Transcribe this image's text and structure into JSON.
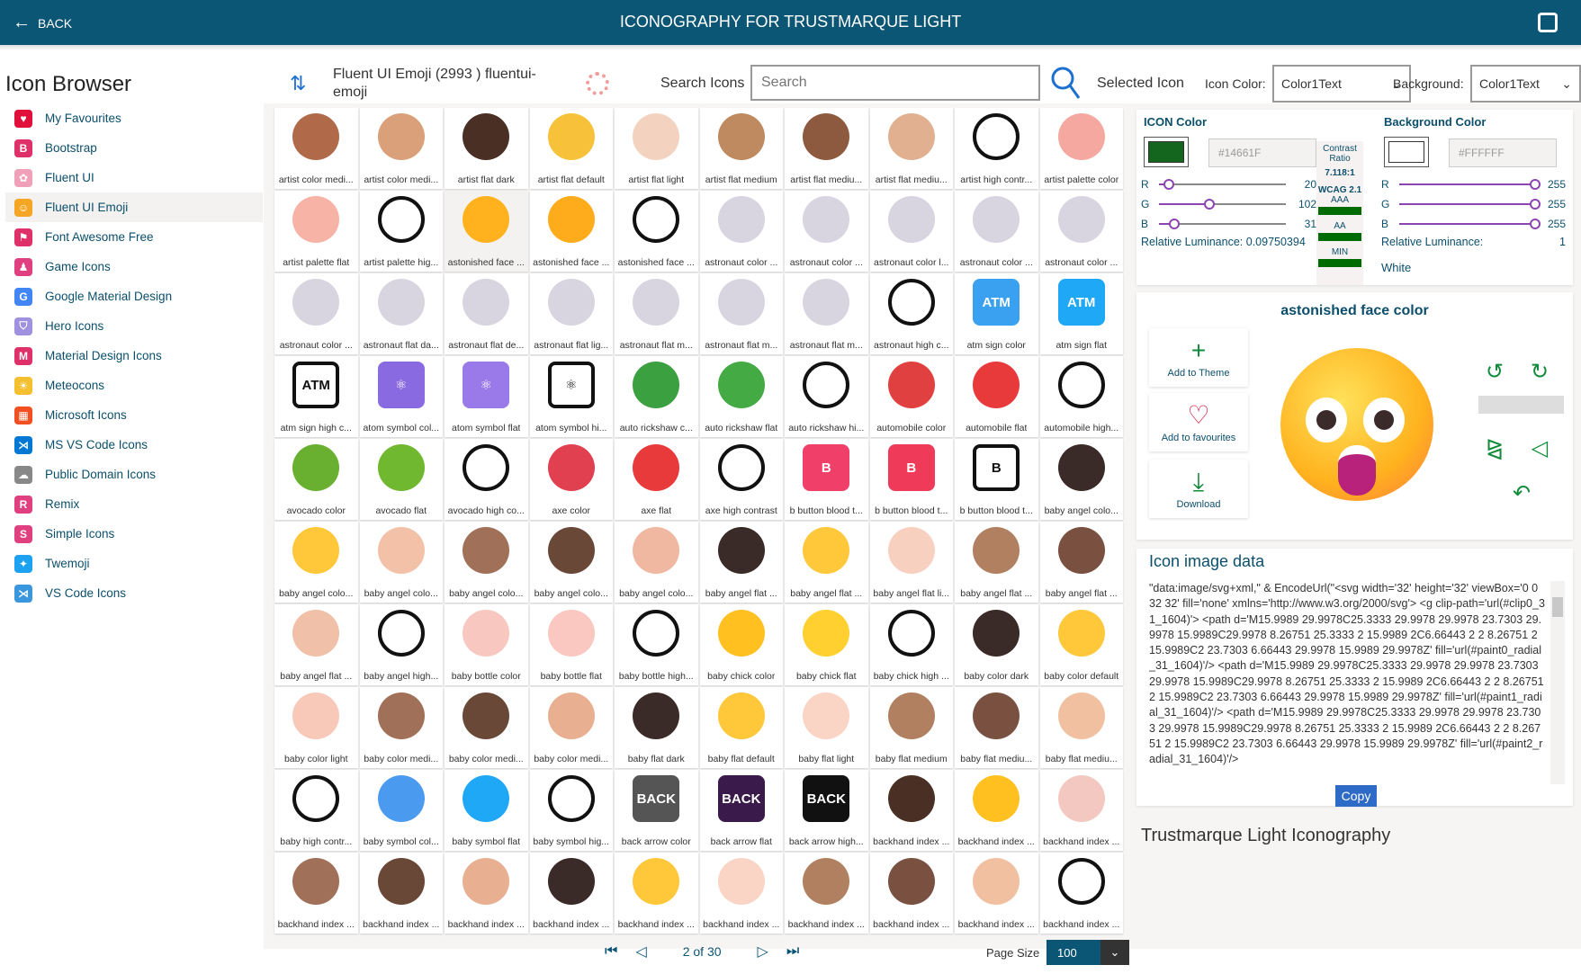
{
  "header": {
    "back_label": "BACK",
    "title": "ICONOGRAPHY FOR TRUSTMARQUE LIGHT"
  },
  "sidebar": {
    "title": "Icon Browser",
    "items": [
      {
        "label": "My Favourites",
        "icon": "heart-icon",
        "color": "#e0103a",
        "glyph": "♥"
      },
      {
        "label": "Bootstrap",
        "icon": "bootstrap-icon",
        "color": "#e0306a",
        "glyph": "B"
      },
      {
        "label": "Fluent UI",
        "icon": "fluent-icon",
        "color": "#f0a0b8",
        "glyph": "✿"
      },
      {
        "label": "Fluent UI Emoji",
        "icon": "cat-emoji-icon",
        "color": "#f5a623",
        "glyph": "☺",
        "active": true
      },
      {
        "label": "Font Awesome Free",
        "icon": "flag-icon",
        "color": "#e0306a",
        "glyph": "⚑"
      },
      {
        "label": "Game Icons",
        "icon": "game-icon",
        "color": "#e04080",
        "glyph": "♟"
      },
      {
        "label": "Google Material Design",
        "icon": "google-icon",
        "color": "#4285f4",
        "glyph": "G"
      },
      {
        "label": "Hero Icons",
        "icon": "shield-icon",
        "color": "#a090e0",
        "glyph": "⛉"
      },
      {
        "label": "Material Design Icons",
        "icon": "material-icon",
        "color": "#e0306a",
        "glyph": "M"
      },
      {
        "label": "Meteocons",
        "icon": "sun-icon",
        "color": "#f5c030",
        "glyph": "☀"
      },
      {
        "label": "Microsoft Icons",
        "icon": "windows-icon",
        "color": "#f25022",
        "glyph": "▦"
      },
      {
        "label": "MS VS Code Icons",
        "icon": "vscode-icon",
        "color": "#0078d4",
        "glyph": "⋊"
      },
      {
        "label": "Public Domain Icons",
        "icon": "cloud-icon",
        "color": "#888888",
        "glyph": "☁"
      },
      {
        "label": "Remix",
        "icon": "remix-icon",
        "color": "#e04080",
        "glyph": "R"
      },
      {
        "label": "Simple Icons",
        "icon": "simple-icon",
        "color": "#e04080",
        "glyph": "S"
      },
      {
        "label": "Twemoji",
        "icon": "twitter-icon",
        "color": "#1da1f2",
        "glyph": "✦"
      },
      {
        "label": "VS Code Icons",
        "icon": "vscode-icon",
        "color": "#3a96dd",
        "glyph": "⋊"
      }
    ]
  },
  "toolbar": {
    "set_name": "Fluent UI Emoji (2993 ) fluentui-emoji",
    "search_label": "Search Icons",
    "search_placeholder": "Search",
    "selected_icon_label": "Selected Icon",
    "icon_color_label": "Icon Color:",
    "icon_color_value": "Color1Text",
    "background_label": "Background:",
    "background_value": "Color1Text"
  },
  "grid": {
    "items": [
      [
        "artist color medi...",
        "#b06a4a",
        ""
      ],
      [
        "artist color medi...",
        "#d9a07a",
        ""
      ],
      [
        "artist flat dark",
        "#4a2f25",
        ""
      ],
      [
        "artist flat default",
        "#f7c23a",
        ""
      ],
      [
        "artist flat light",
        "#f3d3c0",
        ""
      ],
      [
        "artist flat medium",
        "#c08a60",
        ""
      ],
      [
        "artist flat mediu...",
        "#8d5a40",
        ""
      ],
      [
        "artist flat mediu...",
        "#e0b090",
        ""
      ],
      [
        "artist high contr...",
        "hc",
        ""
      ],
      [
        "artist palette color",
        "#f4a8a0",
        ""
      ],
      [
        "artist palette flat",
        "#f7b3a5",
        ""
      ],
      [
        "artist palette hig...",
        "hc",
        ""
      ],
      [
        "astonished face ...",
        "#ffb21e",
        ""
      ],
      [
        "astonished face ...",
        "#ffac1c",
        ""
      ],
      [
        "astonished face ...",
        "hc",
        ""
      ],
      [
        "astronaut color ...",
        "#d8d4e0",
        ""
      ],
      [
        "astronaut color ...",
        "#d8d4e0",
        ""
      ],
      [
        "astronaut color l...",
        "#d8d4e0",
        ""
      ],
      [
        "astronaut color ...",
        "#d8d4e0",
        ""
      ],
      [
        "astronaut color ...",
        "#d8d4e0",
        ""
      ],
      [
        "astronaut color ...",
        "#d8d4e0",
        ""
      ],
      [
        "astronaut flat da...",
        "#d8d4e0",
        ""
      ],
      [
        "astronaut flat de...",
        "#d8d4e0",
        ""
      ],
      [
        "astronaut flat lig...",
        "#d8d4e0",
        ""
      ],
      [
        "astronaut flat m...",
        "#d8d4e0",
        ""
      ],
      [
        "astronaut flat m...",
        "#d8d4e0",
        ""
      ],
      [
        "astronaut flat m...",
        "#d8d4e0",
        ""
      ],
      [
        "astronaut high c...",
        "hc",
        ""
      ],
      [
        "atm sign color",
        "#3aa0f0",
        "ATM"
      ],
      [
        "atm sign flat",
        "#1fa8f5",
        "ATM"
      ],
      [
        "atm sign high c...",
        "hc",
        "ATM"
      ],
      [
        "atom symbol col...",
        "#8a6ae0",
        "⚛"
      ],
      [
        "atom symbol flat",
        "#9a7ae8",
        "⚛"
      ],
      [
        "atom symbol hi...",
        "hc",
        "⚛"
      ],
      [
        "auto rickshaw c...",
        "#3aa040",
        ""
      ],
      [
        "auto rickshaw flat",
        "#44aa44",
        ""
      ],
      [
        "auto rickshaw hi...",
        "hc",
        ""
      ],
      [
        "automobile color",
        "#e04040",
        ""
      ],
      [
        "automobile flat",
        "#e83a3a",
        ""
      ],
      [
        "automobile high...",
        "hc",
        ""
      ],
      [
        "avocado color",
        "#6ab030",
        ""
      ],
      [
        "avocado flat",
        "#70b830",
        ""
      ],
      [
        "avocado high co...",
        "hc",
        ""
      ],
      [
        "axe color",
        "#e04050",
        ""
      ],
      [
        "axe flat",
        "#e83a3a",
        ""
      ],
      [
        "axe high contrast",
        "hc",
        ""
      ],
      [
        "b button blood t...",
        "#f0406a",
        "B"
      ],
      [
        "b button blood t...",
        "#f03a5a",
        "B"
      ],
      [
        "b button blood t...",
        "hc",
        "B"
      ],
      [
        "baby angel colo...",
        "#3a2a28",
        ""
      ],
      [
        "baby angel colo...",
        "#ffc83a",
        ""
      ],
      [
        "baby angel colo...",
        "#f3c0a8",
        ""
      ],
      [
        "baby angel colo...",
        "#a07058",
        ""
      ],
      [
        "baby angel colo...",
        "#6a4838",
        ""
      ],
      [
        "baby angel colo...",
        "#f0b8a0",
        ""
      ],
      [
        "baby angel flat ...",
        "#3a2a28",
        ""
      ],
      [
        "baby angel flat ...",
        "#ffc83a",
        ""
      ],
      [
        "baby angel flat li...",
        "#f8d0c0",
        ""
      ],
      [
        "baby angel flat ...",
        "#b08060",
        ""
      ],
      [
        "baby angel flat ...",
        "#7a5040",
        ""
      ],
      [
        "baby angel flat ...",
        "#f0c0a8",
        ""
      ],
      [
        "baby angel high...",
        "hc",
        ""
      ],
      [
        "baby bottle color",
        "#f8c8c0",
        ""
      ],
      [
        "baby bottle flat",
        "#fac8c0",
        ""
      ],
      [
        "baby bottle high...",
        "hc",
        ""
      ],
      [
        "baby chick color",
        "#ffc020",
        ""
      ],
      [
        "baby chick flat",
        "#ffd030",
        ""
      ],
      [
        "baby chick high ...",
        "hc",
        ""
      ],
      [
        "baby color dark",
        "#3a2a28",
        ""
      ],
      [
        "baby color default",
        "#ffc83a",
        ""
      ],
      [
        "baby color light",
        "#f8c8b8",
        ""
      ],
      [
        "baby color medi...",
        "#a07058",
        ""
      ],
      [
        "baby color medi...",
        "#6a4838",
        ""
      ],
      [
        "baby color medi...",
        "#e8b090",
        ""
      ],
      [
        "baby flat dark",
        "#3a2a28",
        ""
      ],
      [
        "baby flat default",
        "#ffc83a",
        ""
      ],
      [
        "baby flat light",
        "#fad4c4",
        ""
      ],
      [
        "baby flat medium",
        "#b08060",
        ""
      ],
      [
        "baby flat mediu...",
        "#7a5040",
        ""
      ],
      [
        "baby flat mediu...",
        "#f0c0a0",
        ""
      ],
      [
        "baby high contr...",
        "hc",
        ""
      ],
      [
        "baby symbol col...",
        "#4a9af0",
        ""
      ],
      [
        "baby symbol flat",
        "#1fa8f5",
        ""
      ],
      [
        "baby symbol hig...",
        "hc",
        ""
      ],
      [
        "back arrow color",
        "#555555",
        "BACK"
      ],
      [
        "back arrow flat",
        "#3a1a4a",
        "BACK"
      ],
      [
        "back arrow high...",
        "#111111",
        "BACK"
      ],
      [
        "backhand index ...",
        "#4a2f25",
        ""
      ],
      [
        "backhand index ...",
        "#ffc020",
        ""
      ],
      [
        "backhand index ...",
        "#f3c8c0",
        ""
      ],
      [
        "backhand index ...",
        "#a07058",
        ""
      ],
      [
        "backhand index ...",
        "#6a4838",
        ""
      ],
      [
        "backhand index ...",
        "#e8b090",
        ""
      ],
      [
        "backhand index ...",
        "#3a2a28",
        ""
      ],
      [
        "backhand index ...",
        "#ffc83a",
        ""
      ],
      [
        "backhand index ...",
        "#fad4c4",
        ""
      ],
      [
        "backhand index ...",
        "#b08060",
        ""
      ],
      [
        "backhand index ...",
        "#7a5040",
        ""
      ],
      [
        "backhand index ...",
        "#f0c0a0",
        ""
      ],
      [
        "backhand index ...",
        "hc",
        ""
      ]
    ],
    "selected_index": 12
  },
  "pagination": {
    "page_text": "2 of 30",
    "page_size_label": "Page Size",
    "page_size": "100"
  },
  "color_panel": {
    "icon_title": "ICON Color",
    "icon_hex": "#14661F",
    "icon_rgb": {
      "r": 20,
      "g": 102,
      "b": 31
    },
    "icon_luminance_label": "Relative Luminance:",
    "icon_luminance": "0.09750394",
    "bg_title": "Background Color",
    "bg_hex": "#FFFFFF",
    "bg_rgb": {
      "r": 255,
      "g": 255,
      "b": 255
    },
    "bg_luminance_label": "Relative Luminance:",
    "bg_luminance": "1",
    "bg_name": "White",
    "contrast_label": "Contrast Ratio",
    "contrast_value": "7.118:1",
    "wcag_label": "WCAG 2.1",
    "levels": [
      "AAA",
      "AA",
      "MIN"
    ],
    "pass_color": "#006b00",
    "r": "R",
    "g": "G",
    "b": "B"
  },
  "selected": {
    "name": "astonished face color",
    "add_theme": "Add to Theme",
    "add_fav": "Add to favourites",
    "download": "Download"
  },
  "image_data": {
    "title": "Icon image data",
    "text": "\"data:image/svg+xml,\" & EncodeUrl(\"<svg width='32' height='32' viewBox='0 0 32 32' fill='none' xmlns='http://www.w3.org/2000/svg'> <g clip-path='url(#clip0_31_1604)'> <path d='M15.9989 29.9978C25.3333 29.9978 29.9978 23.7303 29.9978 15.9989C29.9978 8.26751 25.3333 2 15.9989 2C6.66443 2 2 8.26751 2 15.9989C2 23.7303 6.66443 29.9978 15.9989 29.9978Z' fill='url(#paint0_radial_31_1604)'/> <path d='M15.9989 29.9978C25.3333 29.9978 29.9978 23.7303 29.9978 15.9989C29.9978 8.26751 25.3333 2 15.9989 2C6.66443 2 2 8.26751 2 15.9989C2 23.7303 6.66443 29.9978 15.9989 29.9978Z' fill='url(#paint1_radial_31_1604)'/> <path d='M15.9989 29.9978C25.3333 29.9978 29.9978 23.7303 29.9978 15.9989C29.9978 8.26751 25.3333 2 15.9989 2C6.66443 2 2 8.26751 2 15.9989C2 23.7303 6.66443 29.9978 15.9989 29.9978Z' fill='url(#paint2_radial_31_1604)'/>",
    "copy_label": "Copy"
  },
  "theme_title": "Trustmarque Light Iconography"
}
